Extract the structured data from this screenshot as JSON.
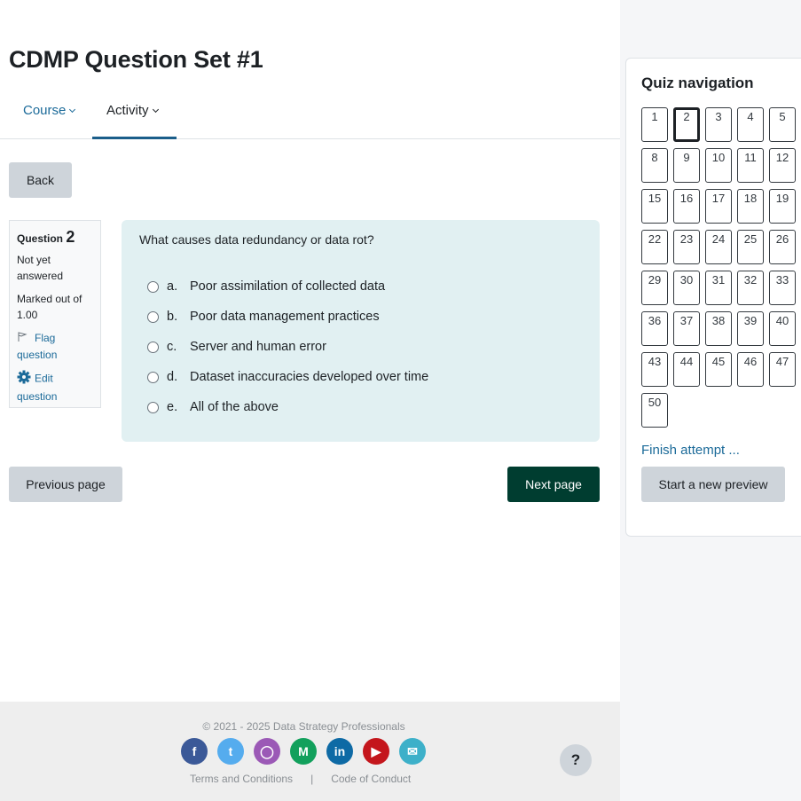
{
  "page": {
    "title": "CDMP Question Set #1"
  },
  "secondary_nav": {
    "tabs": [
      {
        "label": "Course",
        "active": false
      },
      {
        "label": "Activity",
        "active": true
      }
    ]
  },
  "buttons": {
    "back": "Back",
    "previous_page": "Previous page",
    "next_page": "Next page"
  },
  "question_info": {
    "label": "Question",
    "number": "2",
    "state": "Not yet answered",
    "grade": "Marked out of 1.00",
    "flag_label": "Flag question",
    "edit_label": "Edit question"
  },
  "question": {
    "text": "What causes data redundancy or data rot?",
    "answers": [
      {
        "letter": "a.",
        "text": "Poor assimilation of collected data",
        "selected": false
      },
      {
        "letter": "b.",
        "text": "Poor data management practices",
        "selected": false
      },
      {
        "letter": "c.",
        "text": "Server and human error",
        "selected": false
      },
      {
        "letter": "d.",
        "text": "Dataset inaccuracies developed over time",
        "selected": false
      },
      {
        "letter": "e.",
        "text": "All of the above",
        "selected": false
      }
    ]
  },
  "quiz_navigation": {
    "title": "Quiz navigation",
    "current_question": 2,
    "visible_questions": [
      1,
      2,
      3,
      4,
      5,
      8,
      9,
      10,
      11,
      12,
      15,
      16,
      17,
      18,
      19,
      22,
      23,
      24,
      25,
      26,
      29,
      30,
      31,
      32,
      33,
      36,
      37,
      38,
      39,
      40,
      43,
      44,
      45,
      46,
      47,
      50
    ],
    "finish_label": "Finish attempt ...",
    "new_preview_label": "Start a new preview"
  },
  "footer": {
    "copyright": "© 2021 - 2025 Data Strategy Professionals",
    "socials": [
      {
        "name": "facebook",
        "glyph": "f",
        "color": "#3b5998"
      },
      {
        "name": "twitter",
        "glyph": "t",
        "color": "#55acee"
      },
      {
        "name": "github",
        "glyph": "◯",
        "color": "#9b59b6"
      },
      {
        "name": "medium",
        "glyph": "M",
        "color": "#12a05c"
      },
      {
        "name": "linkedin",
        "glyph": "in",
        "color": "#0e6aa5"
      },
      {
        "name": "youtube",
        "glyph": "▶",
        "color": "#c4161c"
      },
      {
        "name": "email",
        "glyph": "✉",
        "color": "#3db0c9"
      }
    ],
    "terms_label": "Terms and Conditions",
    "separator": "|",
    "conduct_label": "Code of Conduct"
  },
  "help": {
    "label": "?"
  }
}
